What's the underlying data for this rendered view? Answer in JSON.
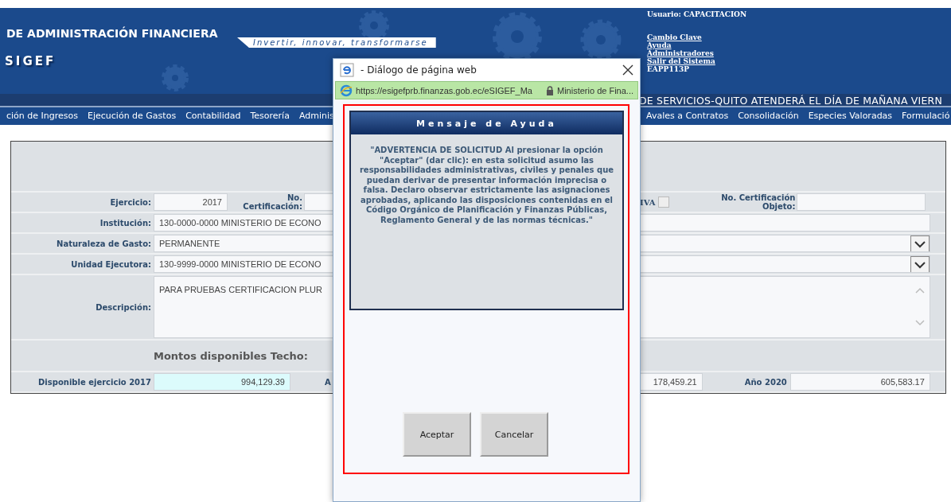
{
  "header": {
    "org_title": "DE ADMINISTRACIÓN FINANCIERA",
    "tagline": "Invertir, innovar, transformarse",
    "system_name": "SIGEF",
    "user_label": "Usuario: CAPACITACION",
    "links": [
      "Cambio Clave",
      "Ayuda",
      "Administradores",
      "Salir del Sistema"
    ],
    "user_code": "EAPP113P"
  },
  "ticker": "DE SERVICIOS-QUITO ATENDERÁ EL DÍA DE MAÑANA VIERN",
  "menu_left": [
    "ción de Ingresos",
    "Ejecución de Gastos",
    "Contabilidad",
    "Tesorería",
    "Adminis"
  ],
  "menu_right": [
    "Avales a Contratos",
    "Consolidación",
    "Especies Valoradas",
    "Formulació"
  ],
  "form": {
    "ejercicio": {
      "label": "Ejercicio:",
      "value": "2017"
    },
    "certificacion": {
      "label": "No. Certificación:"
    },
    "iva": {
      "label": "IVA",
      "checked": false
    },
    "certificacion_objeto": {
      "label": "No. Certificación Objeto:"
    },
    "rows": [
      {
        "kind": "text",
        "label": "Institución:",
        "value": "130-0000-0000 MINISTERIO DE ECONO"
      },
      {
        "kind": "select",
        "label": "Naturaleza de Gasto:",
        "value": "PERMANENTE"
      },
      {
        "kind": "select",
        "label": "Unidad Ejecutora:",
        "value": "130-9999-0000 MINISTERIO DE ECONO"
      },
      {
        "kind": "textarea",
        "label": "Descripción:",
        "value": "PARA PRUEBAS CERTIFICACION PLUR"
      }
    ],
    "section_title": "Montos disponibles Techo:",
    "available": {
      "label": "Disponible ejercicio 2017",
      "value": "994,129.39"
    },
    "year_label_partial": "A",
    "year_value_2019": "178,459.21",
    "year_2020": {
      "label": "Año 2020",
      "value": "605,583.17"
    }
  },
  "dialog": {
    "title": "- Diálogo de página web",
    "url": "https://esigefprb.finanzas.gob.ec/eSIGEF_Ma",
    "site": "Ministerio de Fina...",
    "panel_title": "Mensaje de Ayuda",
    "message": "\"ADVERTENCIA DE SOLICITUD Al presionar la opción \"Aceptar\" (dar clic): en esta solicitud asumo las responsabilidades administrativas, civiles y penales que puedan derivar de presentar información imprecisa o falsa. Declaro observar estrictamente las asignaciones aprobadas, aplicando las disposiciones contenidas en el Código Orgánico de Planificación y Finanzas Públicas, Reglamento General y de las normas técnicas.\"",
    "buttons": [
      "Aceptar",
      "Cancelar"
    ]
  }
}
